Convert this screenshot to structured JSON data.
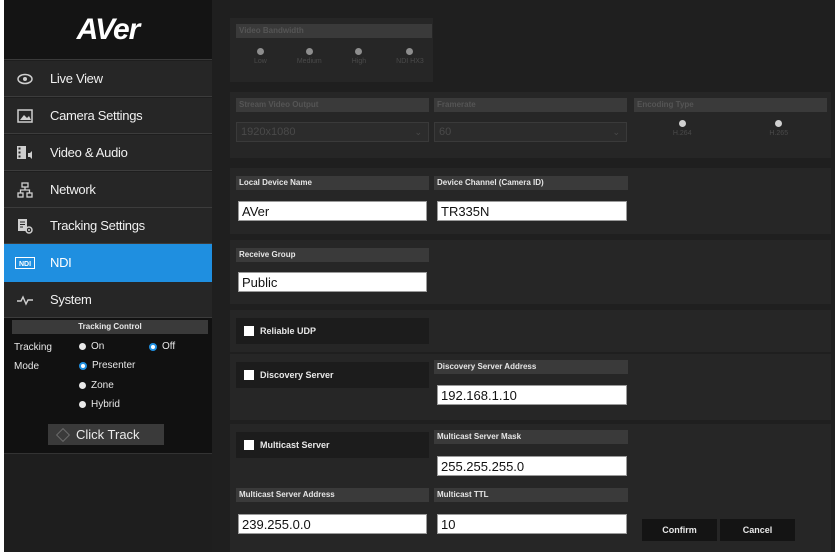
{
  "sidebar": {
    "logo": "AVer",
    "items": [
      {
        "label": "Live View",
        "icon": "eye-icon"
      },
      {
        "label": "Camera Settings",
        "icon": "image-icon"
      },
      {
        "label": "Video & Audio",
        "icon": "film-audio-icon"
      },
      {
        "label": "Network",
        "icon": "network-icon"
      },
      {
        "label": "Tracking Settings",
        "icon": "document-gear-icon"
      },
      {
        "label": "NDI",
        "icon": "ndi-icon"
      },
      {
        "label": "System",
        "icon": "pulse-icon"
      }
    ],
    "active": "NDI",
    "tracking_control": {
      "title": "Tracking Control",
      "tracking_label": "Tracking",
      "on_label": "On",
      "off_label": "Off",
      "tracking_selected": "Off",
      "mode_label": "Mode",
      "modes": [
        "Presenter",
        "Zone",
        "Hybrid"
      ],
      "mode_selected": "Presenter",
      "click_track_label": "Click Track"
    }
  },
  "main": {
    "video_bandwidth": {
      "title": "Video Bandwidth",
      "options": [
        "Low",
        "Medium",
        "High",
        "NDI HX3"
      ]
    },
    "stream_video_output": {
      "title": "Stream Video Output",
      "value": "1920x1080"
    },
    "framerate": {
      "title": "Framerate",
      "value": "60"
    },
    "encoding_type": {
      "title": "Encoding Type",
      "options": [
        "H.264",
        "H.265"
      ]
    },
    "local_device_name": {
      "label": "Local Device Name",
      "value": "AVer"
    },
    "device_channel": {
      "label": "Device Channel (Camera ID)",
      "value": "TR335N"
    },
    "receive_group": {
      "label": "Receive Group",
      "value": "Public"
    },
    "reliable_udp": {
      "label": "Reliable UDP"
    },
    "discovery_server": {
      "label": "Discovery Server"
    },
    "discovery_server_address": {
      "label": "Discovery Server Address",
      "value": "192.168.1.10"
    },
    "multicast_server": {
      "label": "Multicast Server"
    },
    "multicast_server_mask": {
      "label": "Multicast Server Mask",
      "value": "255.255.255.0"
    },
    "multicast_server_address": {
      "label": "Multicast Server Address",
      "value": "239.255.0.0"
    },
    "multicast_ttl": {
      "label": "Multicast TTL",
      "value": "10"
    },
    "confirm_label": "Confirm",
    "cancel_label": "Cancel"
  },
  "colors": {
    "accent": "#1f8fe0",
    "sidebar_bg": "#1e1e1e",
    "panel_bg": "#262626"
  }
}
